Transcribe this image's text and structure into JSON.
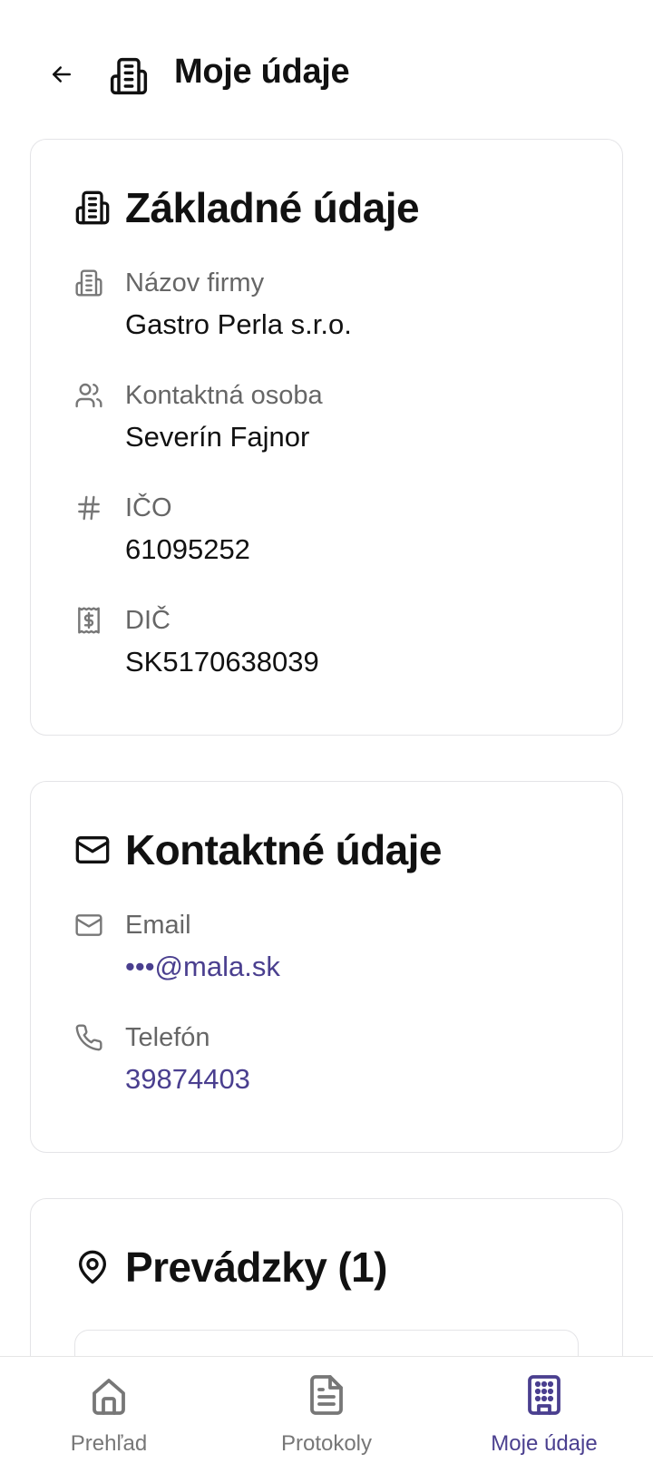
{
  "colors": {
    "accent": "#4a3f8f",
    "muted": "#666666",
    "border": "#e4e4e7"
  },
  "header": {
    "title": "Moje údaje",
    "back_icon": "arrow-left-icon",
    "title_icon": "building-icon"
  },
  "basic": {
    "title": "Základné údaje",
    "icon": "building-icon",
    "fields": [
      {
        "label": "Názov firmy",
        "value": "Gastro Perla s.r.o.",
        "icon": "building-icon"
      },
      {
        "label": "Kontaktná osoba",
        "value": "Severín Fajnor",
        "icon": "users-icon"
      },
      {
        "label": "IČO",
        "value": "61095252",
        "icon": "hash-icon"
      },
      {
        "label": "DIČ",
        "value": "SK5170638039",
        "icon": "receipt-icon"
      }
    ]
  },
  "contact": {
    "title": "Kontaktné údaje",
    "icon": "mail-icon",
    "fields": [
      {
        "label": "Email",
        "value": "•••@mala.sk",
        "icon": "mail-icon"
      },
      {
        "label": "Telefón",
        "value": "39874403",
        "icon": "phone-icon"
      }
    ]
  },
  "premises": {
    "title": "Prevádzky (1)",
    "icon": "map-pin-icon"
  },
  "tabbar": {
    "active": "Moje údaje",
    "tabs": [
      {
        "label": "Prehľad",
        "icon": "home-icon"
      },
      {
        "label": "Protokoly",
        "icon": "document-icon"
      },
      {
        "label": "Moje údaje",
        "icon": "building-icon"
      }
    ]
  }
}
